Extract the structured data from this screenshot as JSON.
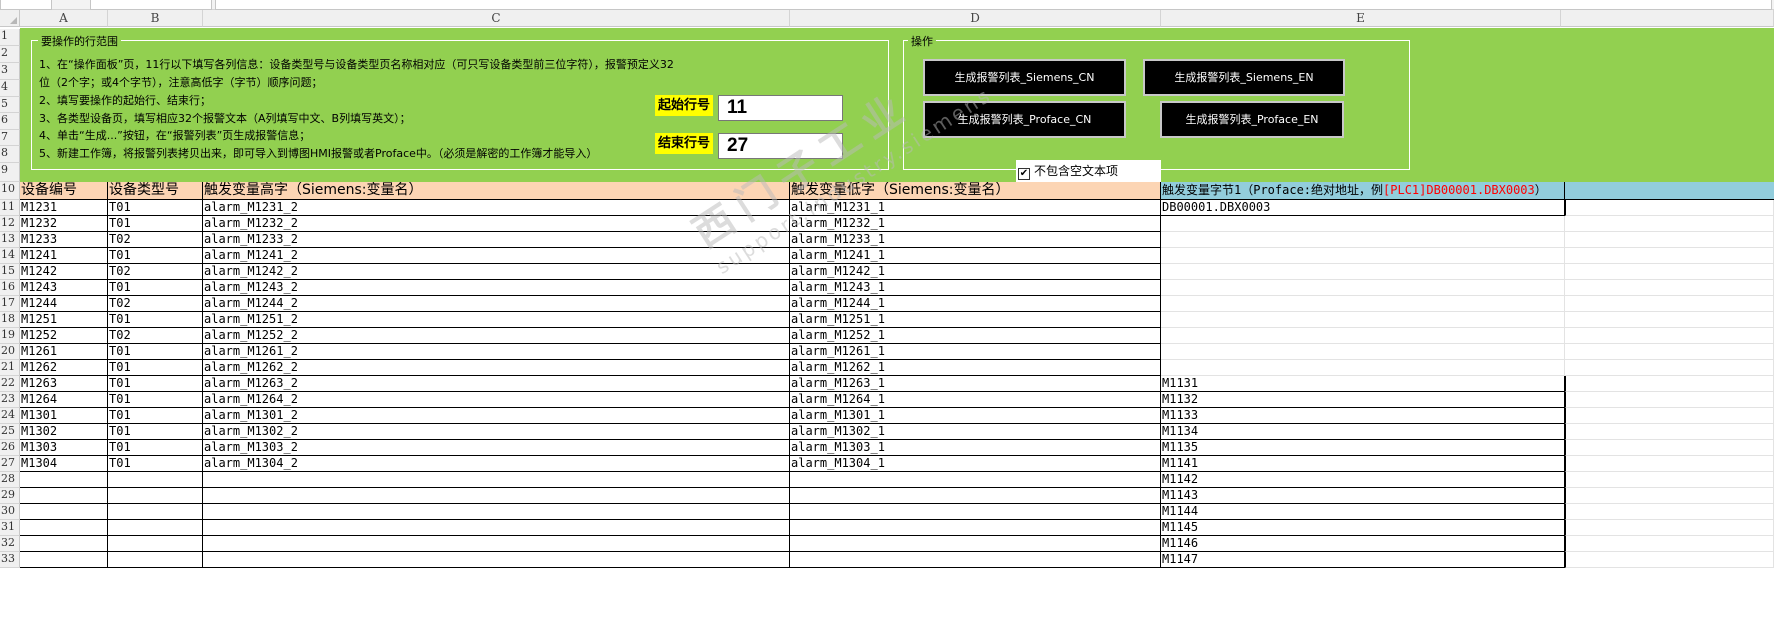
{
  "column_headers": [
    "A",
    "B",
    "C",
    "D",
    "E"
  ],
  "row_numbers": [
    "1",
    "2",
    "3",
    "4",
    "5",
    "6",
    "7",
    "8",
    "9",
    "10",
    "11",
    "12",
    "13",
    "14",
    "15",
    "16",
    "17",
    "18",
    "19",
    "20",
    "21",
    "22",
    "23",
    "24",
    "25",
    "26",
    "27",
    "28",
    "29",
    "30",
    "31",
    "32",
    "33"
  ],
  "panel": {
    "range_title": "要操作的行范围",
    "instructions": [
      "1、在“操作面板”页，11行以下填写各列信息：设备类型号与设备类型页名称相对应（可只写设备类型前三位字符），报警预定义32",
      "位（2个字；或4个字节），注意高低字（字节）顺序问题；",
      "2、填写要操作的起始行、结束行；",
      "3、各类型设备页，填写相应32个报警文本（A列填写中文、B列填写英文）；",
      "4、单击“生成...”按钮，在“报警列表”页生成报警信息；",
      "5、新建工作簿，将报警列表拷贝出来，即可导入到博图HMI报警或者Proface中。（必须是解密的工作簿才能导入）"
    ],
    "start_row_label": "起始行号",
    "start_row_value": "11",
    "end_row_label": "结束行号",
    "end_row_value": "27",
    "ops_title": "操作",
    "buttons": [
      "生成报警列表_Siemens_CN",
      "生成报警列表_Siemens_EN",
      "生成报警列表_Proface_CN",
      "生成报警列表_Proface_EN"
    ],
    "checkbox_mark": "✔",
    "checkbox_label": "不包含空文本项"
  },
  "table": {
    "headers": [
      "设备编号",
      "设备类型号",
      "触发变量高字（Siemens:变量名）",
      "触发变量低字（Siemens:变量名）"
    ],
    "header_e_prefix": "触发变量字节1（Proface:绝对地址，例",
    "header_e_red": "[PLC1]",
    "header_e_suffix": "DB00001.DBX0003",
    "header_e_close": "）",
    "rows": [
      {
        "a": "M1231",
        "b": "T01",
        "c": "alarm_M1231_2",
        "d": "alarm_M1231_1",
        "e": "DB00001.DBX0003"
      },
      {
        "a": "M1232",
        "b": "T01",
        "c": "alarm_M1232_2",
        "d": "alarm_M1232_1",
        "e": ""
      },
      {
        "a": "M1233",
        "b": "T02",
        "c": "alarm_M1233_2",
        "d": "alarm_M1233_1",
        "e": ""
      },
      {
        "a": "M1241",
        "b": "T01",
        "c": "alarm_M1241_2",
        "d": "alarm_M1241_1",
        "e": ""
      },
      {
        "a": "M1242",
        "b": "T02",
        "c": "alarm_M1242_2",
        "d": "alarm_M1242_1",
        "e": ""
      },
      {
        "a": "M1243",
        "b": "T01",
        "c": "alarm_M1243_2",
        "d": "alarm_M1243_1",
        "e": ""
      },
      {
        "a": "M1244",
        "b": "T02",
        "c": "alarm_M1244_2",
        "d": "alarm_M1244_1",
        "e": ""
      },
      {
        "a": "M1251",
        "b": "T01",
        "c": "alarm_M1251_2",
        "d": "alarm_M1251_1",
        "e": ""
      },
      {
        "a": "M1252",
        "b": "T02",
        "c": "alarm_M1252_2",
        "d": "alarm_M1252_1",
        "e": ""
      },
      {
        "a": "M1261",
        "b": "T01",
        "c": "alarm_M1261_2",
        "d": "alarm_M1261_1",
        "e": ""
      },
      {
        "a": "M1262",
        "b": "T01",
        "c": "alarm_M1262_2",
        "d": "alarm_M1262_1",
        "e": ""
      },
      {
        "a": "M1263",
        "b": "T01",
        "c": "alarm_M1263_2",
        "d": "alarm_M1263_1",
        "e": "M1131"
      },
      {
        "a": "M1264",
        "b": "T01",
        "c": "alarm_M1264_2",
        "d": "alarm_M1264_1",
        "e": "M1132"
      },
      {
        "a": "M1301",
        "b": "T01",
        "c": "alarm_M1301_2",
        "d": "alarm_M1301_1",
        "e": "M1133"
      },
      {
        "a": "M1302",
        "b": "T01",
        "c": "alarm_M1302_2",
        "d": "alarm_M1302_1",
        "e": "M1134"
      },
      {
        "a": "M1303",
        "b": "T01",
        "c": "alarm_M1303_2",
        "d": "alarm_M1303_1",
        "e": "M1135"
      },
      {
        "a": "M1304",
        "b": "T01",
        "c": "alarm_M1304_2",
        "d": "alarm_M1304_1",
        "e": "M1141"
      },
      {
        "a": "",
        "b": "",
        "c": "",
        "d": "",
        "e": "M1142"
      },
      {
        "a": "",
        "b": "",
        "c": "",
        "d": "",
        "e": "M1143"
      },
      {
        "a": "",
        "b": "",
        "c": "",
        "d": "",
        "e": "M1144"
      },
      {
        "a": "",
        "b": "",
        "c": "",
        "d": "",
        "e": "M1145"
      },
      {
        "a": "",
        "b": "",
        "c": "",
        "d": "",
        "e": "M1146"
      },
      {
        "a": "",
        "b": "",
        "c": "",
        "d": "",
        "e": "M1147"
      }
    ]
  },
  "watermark": {
    "main": "西门子工业",
    "sub": "support.industry.siemens"
  }
}
